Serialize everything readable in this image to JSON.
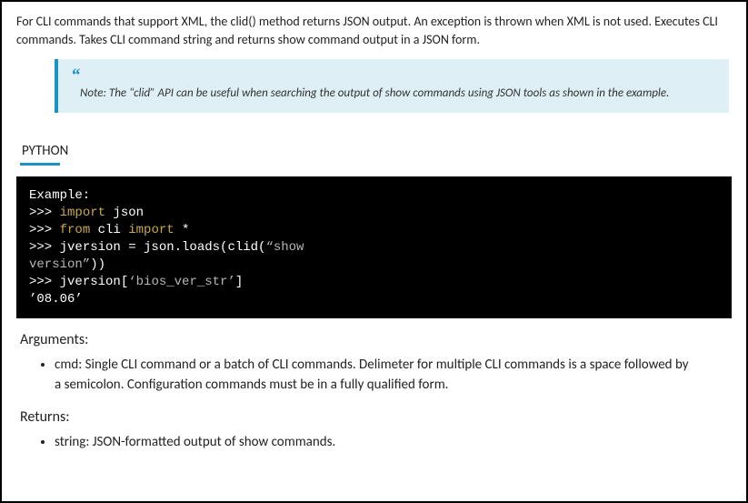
{
  "intro": "For CLI commands that support XML, the clid() method returns JSON output. An exception is thrown when XML  is not used. Executes CLI commands. Takes CLI command string and returns show command output in a JSON form.",
  "note": {
    "quote_mark": "“",
    "text": "Note: The “clid” API can be useful when searching the output of show  commands using JSON tools as shown in the example."
  },
  "language_label": "PYTHON",
  "code": {
    "example_label": "Example:",
    "l1_prompt": ">>> ",
    "l1_import": "import",
    "l1_rest": " json",
    "l2_prompt": ">>> ",
    "l2_from": "from",
    "l2_mid": " cli ",
    "l2_import": "import",
    "l2_rest": " *",
    "l3_prompt": ">>> ",
    "l3_code": "jversion = json.loads(clid(",
    "l3_str": "“show",
    "l4_str": "version”",
    "l4_rest": "))",
    "l5_prompt": ">>> ",
    "l5_code": "jversion[",
    "l5_str": "‘bios_ver_str’",
    "l5_end": "]",
    "l6": "’08.06’"
  },
  "arguments": {
    "heading": "Arguments:",
    "item": "cmd: Single CLI command or a batch of CLI commands. Delimeter for multiple CLI commands is a space followed by a semicolon. Configuration commands must be in a fully qualified form."
  },
  "returns": {
    "heading": "Returns:",
    "item": "string: JSON-formatted output of show commands."
  }
}
